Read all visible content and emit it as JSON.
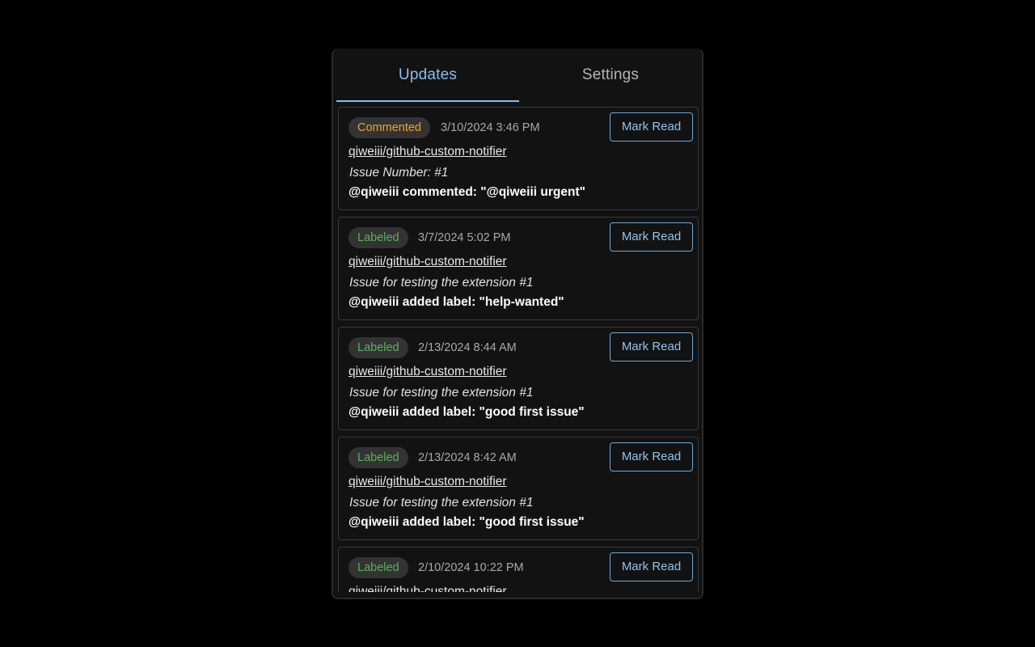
{
  "tabs": [
    {
      "label": "Updates",
      "active": true
    },
    {
      "label": "Settings",
      "active": false
    }
  ],
  "colors": {
    "accent": "#86c0ec",
    "commented": "#f0a030",
    "labeled": "#58b35c",
    "background": "#121212"
  },
  "notifications": [
    {
      "type": "Commented",
      "date": "3/10/2024 3:46 PM",
      "repo": "qiweiii/github-custom-notifier",
      "issue": "Issue Number: #1",
      "action": "@qiweiii commented: \"@qiweiii urgent\"",
      "button": "Mark Read"
    },
    {
      "type": "Labeled",
      "date": "3/7/2024 5:02 PM",
      "repo": "qiweiii/github-custom-notifier",
      "issue": "Issue for testing the extension #1",
      "action": "@qiweiii added label: \"help-wanted\"",
      "button": "Mark Read"
    },
    {
      "type": "Labeled",
      "date": "2/13/2024 8:44 AM",
      "repo": "qiweiii/github-custom-notifier",
      "issue": "Issue for testing the extension #1",
      "action": "@qiweiii added label: \"good first issue\"",
      "button": "Mark Read"
    },
    {
      "type": "Labeled",
      "date": "2/13/2024 8:42 AM",
      "repo": "qiweiii/github-custom-notifier",
      "issue": "Issue for testing the extension #1",
      "action": "@qiweiii added label: \"good first issue\"",
      "button": "Mark Read"
    },
    {
      "type": "Labeled",
      "date": "2/10/2024 10:22 PM",
      "repo": "qiweiii/github-custom-notifier",
      "issue": "",
      "action": "",
      "button": "Mark Read"
    }
  ]
}
